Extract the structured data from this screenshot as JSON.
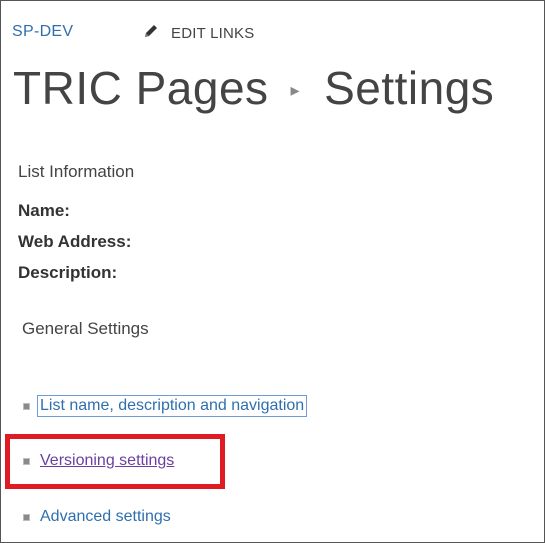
{
  "header": {
    "site_name": "SP-DEV",
    "edit_links_label": "EDIT LINKS",
    "edit_icon": "pencil-icon"
  },
  "title": {
    "list_name": "TRIC Pages",
    "separator": "▸",
    "page_name": "Settings"
  },
  "list_information": {
    "heading": "List Information",
    "fields": [
      {
        "label": "Name:"
      },
      {
        "label": "Web Address:"
      },
      {
        "label": "Description:"
      }
    ]
  },
  "general_settings": {
    "heading": "General Settings",
    "links": [
      {
        "label": "List name, description and navigation",
        "state": "focused"
      },
      {
        "label": "Versioning settings",
        "state": "visited",
        "highlighted": true
      },
      {
        "label": "Advanced settings",
        "state": "normal"
      }
    ]
  },
  "colors": {
    "link": "#2f6fae",
    "visited_link": "#6b3fa0",
    "highlight_border": "#e01b24"
  }
}
